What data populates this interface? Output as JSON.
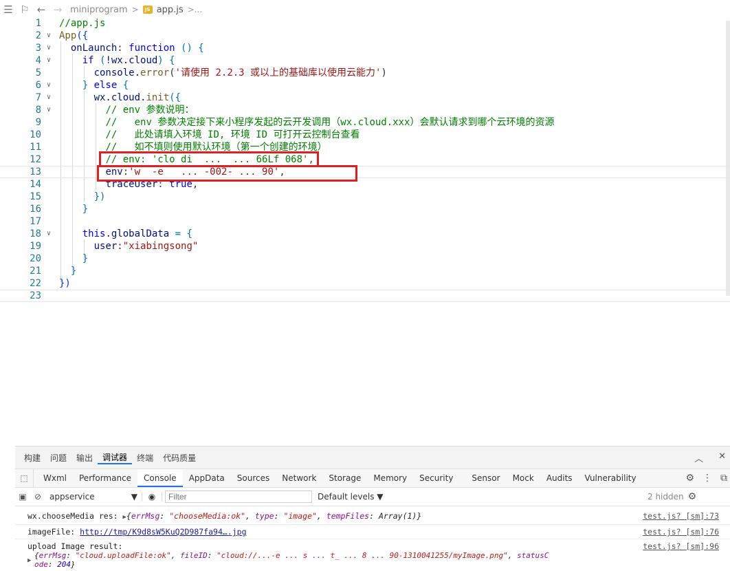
{
  "editor": {
    "breadcrumb": {
      "folder": "miniprogram",
      "separator": ">",
      "file_badge": "JS",
      "file": "app.js",
      "ellipsis": ">..."
    },
    "lines": [
      {
        "n": "1"
      },
      {
        "n": "2"
      },
      {
        "n": "3"
      },
      {
        "n": "4"
      },
      {
        "n": "5"
      },
      {
        "n": "6"
      },
      {
        "n": "7"
      },
      {
        "n": "8"
      },
      {
        "n": "9"
      },
      {
        "n": "10"
      },
      {
        "n": "11"
      },
      {
        "n": "12"
      },
      {
        "n": "13"
      },
      {
        "n": "14"
      },
      {
        "n": "15"
      },
      {
        "n": "16"
      },
      {
        "n": "17"
      },
      {
        "n": "18"
      },
      {
        "n": "19"
      },
      {
        "n": "20"
      },
      {
        "n": "21"
      },
      {
        "n": "22"
      },
      {
        "n": "23"
      }
    ],
    "code": {
      "l1": "//app.js",
      "l2_fn": "App",
      "l2_rest": "({",
      "l3_key": "onLaunch",
      "l3_colon": ": ",
      "l3_kw": "function",
      "l3_rest": " () {",
      "l4_kw": "if",
      "l4_a": " (",
      "l4_b": "!wx.cloud",
      "l4_c": ") {",
      "l5_obj": "console.",
      "l5_fn": "error",
      "l5_a": "(",
      "l5_str": "'请使用 2.2.3 或以上的基础库以使用云能力'",
      "l5_b": ")",
      "l6_a": "} ",
      "l6_kw": "else",
      "l6_b": " {",
      "l7_obj": "wx.cloud.",
      "l7_fn": "init",
      "l7_b": "({",
      "l8": "// env 参数说明：",
      "l9": "//   env 参数决定接下来小程序发起的云开发调用（wx.cloud.xxx）会默认请求到哪个云环境的资源",
      "l10": "//   此处请填入环境 ID, 环境 ID 可打开云控制台查看",
      "l11": "//   如不填则使用默认环境（第一个创建的环境）",
      "l12": "// env: 'clo di  ...  ... 66Lf 068',",
      "l13_key": "env",
      "l13_colon": ":",
      "l13_str": "'w  -e   ... -002- ... 90'",
      "l13_end": ",",
      "l14_key": "traceUser",
      "l14_colon": ": ",
      "l14_val": "true",
      "l14_end": ",",
      "l15": "})",
      "l16": "}",
      "l18_kw": "this",
      "l18_rest": ".globalData",
      "l18_eq": " = {",
      "l19_key": "user",
      "l19_colon": ":",
      "l19_str": "\"xiabingsong\"",
      "l20": "}",
      "l21": "}",
      "l22": "})"
    }
  },
  "devtools": {
    "panel_tabs": [
      "构建",
      "问题",
      "输出",
      "调试器",
      "终端",
      "代码质量"
    ],
    "panel_active": "调试器",
    "tool_tabs": [
      "Wxml",
      "Performance",
      "Console",
      "AppData",
      "Sources",
      "Network",
      "Storage",
      "Memory",
      "Security",
      "Sensor",
      "Mock",
      "Audits",
      "Vulnerability"
    ],
    "tool_active": "Console",
    "context": "appservice",
    "filter_placeholder": "Filter",
    "levels": "Default levels ▼",
    "hidden": "2 hidden",
    "messages": {
      "m1_label": "wx.chooseMedia res: ",
      "m1_tri": "▶",
      "m1_obj_a": "{",
      "m1_k1": "errMsg",
      "m1_v1": "\"chooseMedia:ok\"",
      "m1_k2": "type",
      "m1_v2": "\"image\"",
      "m1_k3": "tempFiles",
      "m1_v3": "Array(1)",
      "m1_obj_b": "}",
      "m1_src": "test.js? [sm]:73",
      "m2_label": "imageFile: ",
      "m2_link": "http://tmp/K9d8sW5KuQ2D987fa94….jpg",
      "m2_src": "test.js? [sm]:76",
      "m3_label": "upload Image result:",
      "m3_src": "test.js? [sm]:96",
      "m3_tri": "▶",
      "m3_k1": "errMsg",
      "m3_v1": "\"cloud.uploadFile:ok\"",
      "m3_k2": "fileID",
      "m3_v2": "\"cloud://...-e ... s ... t_ ... 8 ... 90-1310041255/myImage.png\"",
      "m3_k3": "statusC",
      "m3_k3b": "ode",
      "m3_v3": "204"
    }
  }
}
